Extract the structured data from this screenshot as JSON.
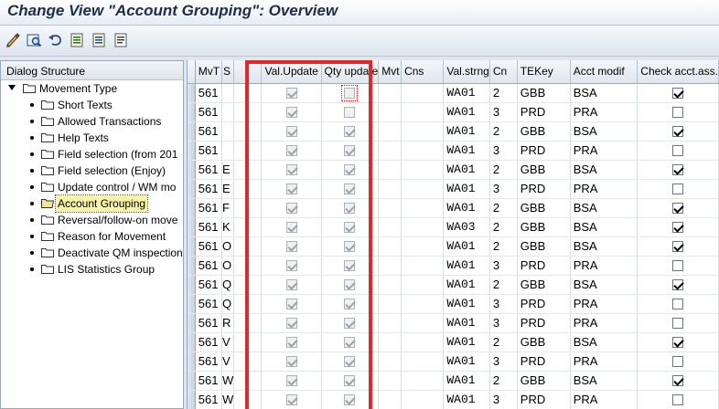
{
  "title": "Change View \"Account Grouping\": Overview",
  "toolbar": {
    "icons": [
      "display-change-icon",
      "detail-icon",
      "undo-icon",
      "previous-entry-icon",
      "next-entry-icon",
      "other-entry-icon"
    ]
  },
  "dialog_structure": {
    "header": "Dialog Structure",
    "root": "Movement Type",
    "items": [
      "Short Texts",
      "Allowed Transactions",
      "Help Texts",
      "Field selection (from 201",
      "Field selection (Enjoy)",
      "Update control / WM mo",
      "Account Grouping",
      "Reversal/follow-on move",
      "Reason for Movement",
      "Deactivate QM inspection",
      "LIS Statistics Group"
    ],
    "selected_index": 6
  },
  "table": {
    "columns": [
      "MvT",
      "S",
      "Val.Update",
      "Qty update",
      "Mvt",
      "Cns",
      "Val.strng",
      "Cn",
      "TEKey",
      "Acct modif",
      "Check acct.ass."
    ],
    "rows": [
      {
        "mvt": "561",
        "s": "",
        "val": true,
        "qty": false,
        "m": "",
        "c": "",
        "vs": "WA01",
        "cn": "2",
        "te": "GBB",
        "am": "BSA",
        "ck": true
      },
      {
        "mvt": "561",
        "s": "",
        "val": true,
        "qty": false,
        "m": "",
        "c": "",
        "vs": "WA01",
        "cn": "3",
        "te": "PRD",
        "am": "PRA",
        "ck": false
      },
      {
        "mvt": "561",
        "s": "",
        "val": true,
        "qty": true,
        "m": "",
        "c": "",
        "vs": "WA01",
        "cn": "2",
        "te": "GBB",
        "am": "BSA",
        "ck": true
      },
      {
        "mvt": "561",
        "s": "",
        "val": true,
        "qty": true,
        "m": "",
        "c": "",
        "vs": "WA01",
        "cn": "3",
        "te": "PRD",
        "am": "PRA",
        "ck": false
      },
      {
        "mvt": "561",
        "s": "E",
        "val": true,
        "qty": true,
        "m": "",
        "c": "",
        "vs": "WA01",
        "cn": "2",
        "te": "GBB",
        "am": "BSA",
        "ck": true
      },
      {
        "mvt": "561",
        "s": "E",
        "val": true,
        "qty": true,
        "m": "",
        "c": "",
        "vs": "WA01",
        "cn": "3",
        "te": "PRD",
        "am": "PRA",
        "ck": false
      },
      {
        "mvt": "561",
        "s": "F",
        "val": true,
        "qty": true,
        "m": "",
        "c": "",
        "vs": "WA01",
        "cn": "2",
        "te": "GBB",
        "am": "BSA",
        "ck": true
      },
      {
        "mvt": "561",
        "s": "K",
        "val": true,
        "qty": true,
        "m": "",
        "c": "",
        "vs": "WA03",
        "cn": "2",
        "te": "GBB",
        "am": "BSA",
        "ck": true
      },
      {
        "mvt": "561",
        "s": "O",
        "val": true,
        "qty": true,
        "m": "",
        "c": "",
        "vs": "WA01",
        "cn": "2",
        "te": "GBB",
        "am": "BSA",
        "ck": true
      },
      {
        "mvt": "561",
        "s": "O",
        "val": true,
        "qty": true,
        "m": "",
        "c": "",
        "vs": "WA01",
        "cn": "3",
        "te": "PRD",
        "am": "PRA",
        "ck": false
      },
      {
        "mvt": "561",
        "s": "Q",
        "val": true,
        "qty": true,
        "m": "",
        "c": "",
        "vs": "WA01",
        "cn": "2",
        "te": "GBB",
        "am": "BSA",
        "ck": true
      },
      {
        "mvt": "561",
        "s": "Q",
        "val": true,
        "qty": true,
        "m": "",
        "c": "",
        "vs": "WA01",
        "cn": "3",
        "te": "PRD",
        "am": "PRA",
        "ck": false
      },
      {
        "mvt": "561",
        "s": "R",
        "val": true,
        "qty": true,
        "m": "",
        "c": "",
        "vs": "WA01",
        "cn": "3",
        "te": "PRD",
        "am": "PRA",
        "ck": false
      },
      {
        "mvt": "561",
        "s": "V",
        "val": true,
        "qty": true,
        "m": "",
        "c": "",
        "vs": "WA01",
        "cn": "2",
        "te": "GBB",
        "am": "BSA",
        "ck": true
      },
      {
        "mvt": "561",
        "s": "V",
        "val": true,
        "qty": true,
        "m": "",
        "c": "",
        "vs": "WA01",
        "cn": "3",
        "te": "PRD",
        "am": "PRA",
        "ck": false
      },
      {
        "mvt": "561",
        "s": "W",
        "val": true,
        "qty": true,
        "m": "",
        "c": "",
        "vs": "WA01",
        "cn": "2",
        "te": "GBB",
        "am": "BSA",
        "ck": true
      },
      {
        "mvt": "561",
        "s": "W",
        "val": true,
        "qty": true,
        "m": "",
        "c": "",
        "vs": "WA01",
        "cn": "3",
        "te": "PRD",
        "am": "PRA",
        "ck": false
      }
    ]
  },
  "colors": {
    "highlight": "#e3262a",
    "selected_node": "#f7f3a8",
    "panel_bg": "#dfe6ee"
  }
}
